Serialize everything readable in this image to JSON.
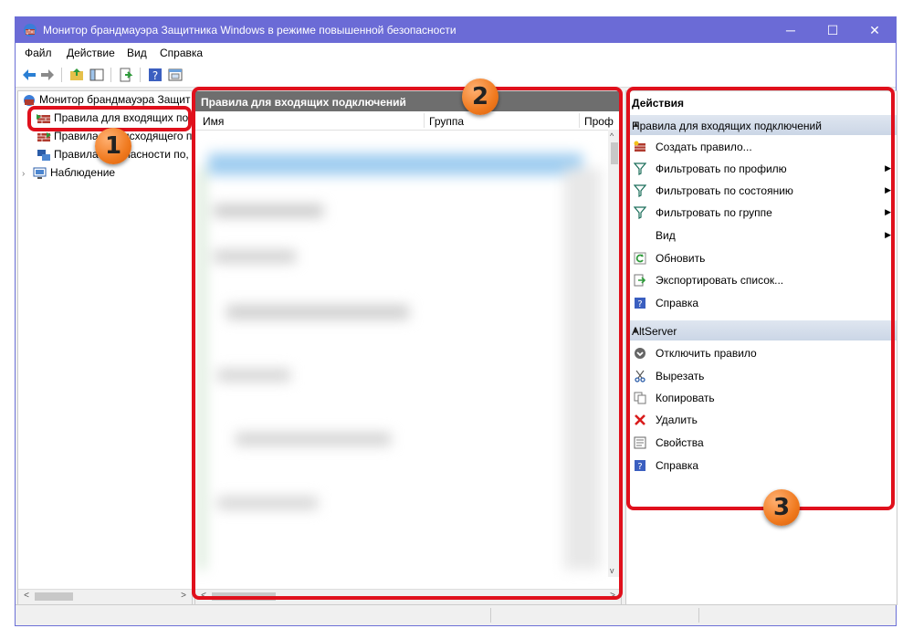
{
  "window": {
    "title": "Монитор брандмауэра Защитника Windows в режиме повышенной безопасности",
    "controls": {
      "minimize": "─",
      "maximize": "☐",
      "close": "✕"
    }
  },
  "menu": [
    "Файл",
    "Действие",
    "Вид",
    "Справка"
  ],
  "toolbar": {
    "icons": [
      "back-icon",
      "forward-icon",
      "up-folder-icon",
      "show-hide-tree-icon",
      "export-icon",
      "help-icon",
      "properties-icon"
    ]
  },
  "tree": {
    "root": "Монитор брандмауэра Защит",
    "items": [
      {
        "label": "Правила для входящих по",
        "icon": "inbound-rules-icon"
      },
      {
        "label": "Правила для исходящего п",
        "icon": "outbound-rules-icon"
      },
      {
        "label": "Правила безопасности по,",
        "icon": "security-rules-icon"
      },
      {
        "label": "Наблюдение",
        "icon": "monitoring-icon"
      }
    ]
  },
  "center": {
    "header": "Правила для входящих подключений",
    "columns": [
      "Имя",
      "Группа",
      "Проф"
    ]
  },
  "actions": {
    "header": "Действия",
    "sections": [
      {
        "title": "Правила для входящих подключений",
        "items": [
          {
            "label": "Создать правило...",
            "icon": "new-rule-icon",
            "submenu": false
          },
          {
            "label": "Фильтровать по профилю",
            "icon": "filter-icon",
            "submenu": true
          },
          {
            "label": "Фильтровать по состоянию",
            "icon": "filter-icon",
            "submenu": true
          },
          {
            "label": "Фильтровать по группе",
            "icon": "filter-icon",
            "submenu": true
          },
          {
            "label": "Вид",
            "icon": "",
            "submenu": true
          },
          {
            "label": "Обновить",
            "icon": "refresh-icon",
            "submenu": false
          },
          {
            "label": "Экспортировать список...",
            "icon": "export-icon",
            "submenu": false
          },
          {
            "label": "Справка",
            "icon": "help-icon",
            "submenu": false
          }
        ]
      },
      {
        "title": "AltServer",
        "items": [
          {
            "label": "Отключить правило",
            "icon": "disable-icon",
            "submenu": false
          },
          {
            "label": "Вырезать",
            "icon": "cut-icon",
            "submenu": false
          },
          {
            "label": "Копировать",
            "icon": "copy-icon",
            "submenu": false
          },
          {
            "label": "Удалить",
            "icon": "delete-icon",
            "submenu": false
          },
          {
            "label": "Свойства",
            "icon": "properties-icon",
            "submenu": false
          },
          {
            "label": "Справка",
            "icon": "help-icon",
            "submenu": false
          }
        ]
      }
    ]
  },
  "callouts": [
    "1",
    "2",
    "3"
  ],
  "colors": {
    "titlebar": "#6b6bd6",
    "callout": "#e0101c",
    "badge": "#f07a1f",
    "section": "#cbd6e6"
  }
}
